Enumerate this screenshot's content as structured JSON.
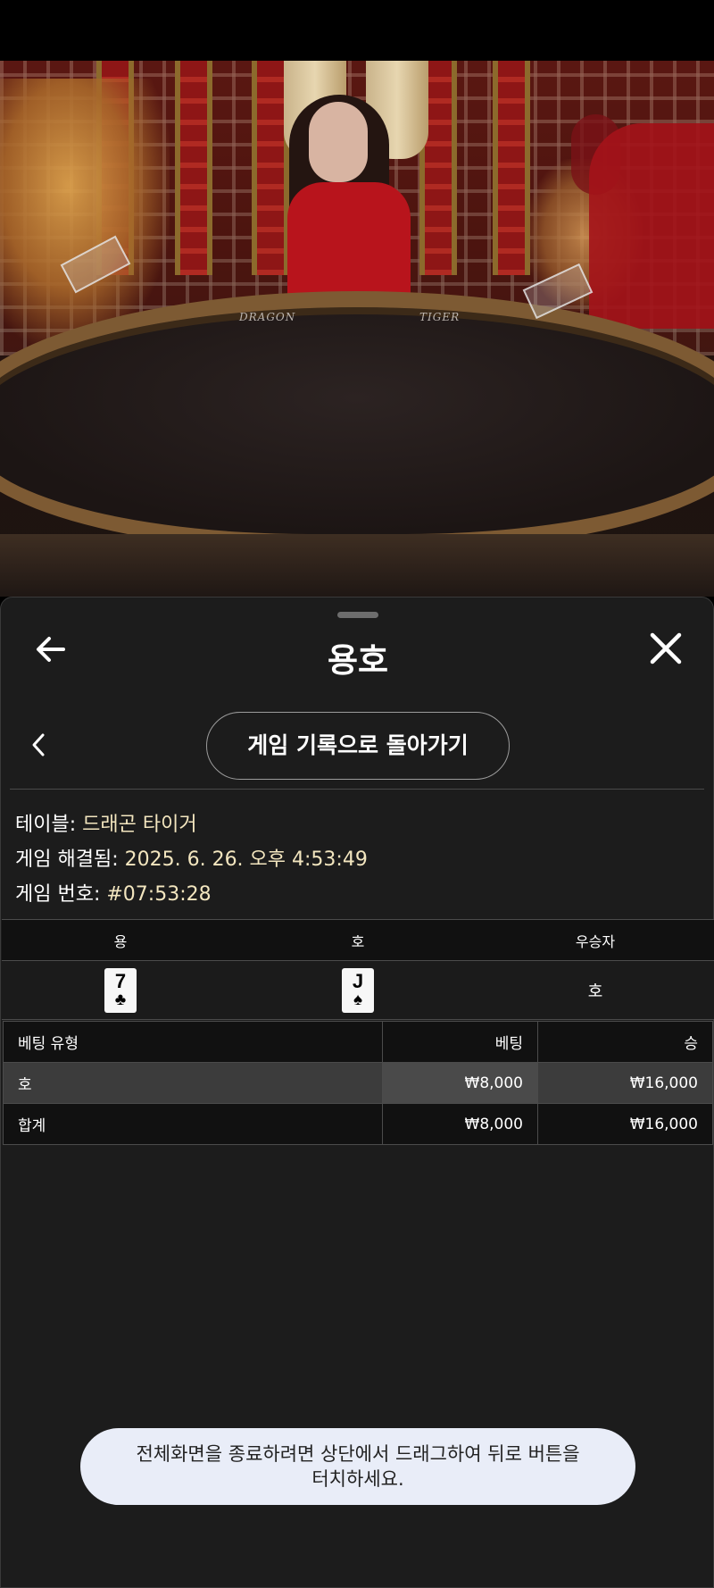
{
  "video": {
    "table_label_left": "DRAGON",
    "table_label_right": "TIGER"
  },
  "sheet": {
    "title": "용호",
    "history_button_label": "게임 기록으로 돌아가기"
  },
  "info": {
    "table_label": "테이블:",
    "table_value": "드래곤 타이거",
    "resolved_label": "게임 해결됨:",
    "resolved_value": "2025. 6. 26. 오후 4:53:49",
    "game_no_label": "게임 번호:",
    "game_no_value": "#07:53:28"
  },
  "results": {
    "headers": [
      "용",
      "호",
      "우승자"
    ],
    "dragon_card": {
      "rank": "7",
      "suit": "♣"
    },
    "tiger_card": {
      "rank": "J",
      "suit": "♠"
    },
    "winner": "호"
  },
  "bets": {
    "headers": [
      "베팅 유형",
      "베팅",
      "승"
    ],
    "rows": [
      {
        "type": "호",
        "bet": "₩8,000",
        "win": "₩16,000"
      }
    ],
    "total": {
      "type": "합계",
      "bet": "₩8,000",
      "win": "₩16,000"
    }
  },
  "toast": {
    "line1": "전체화면을 종료하려면 상단에서 드래그하여 뒤로 버튼을",
    "line2": "터치하세요."
  },
  "colors": {
    "sheet_bg": "#1c1c1c",
    "highlight_text": "#f3e6bf",
    "toast_bg": "#e9edf8"
  },
  "icons": [
    "arrow-left-icon",
    "close-icon",
    "chevron-left-icon"
  ]
}
